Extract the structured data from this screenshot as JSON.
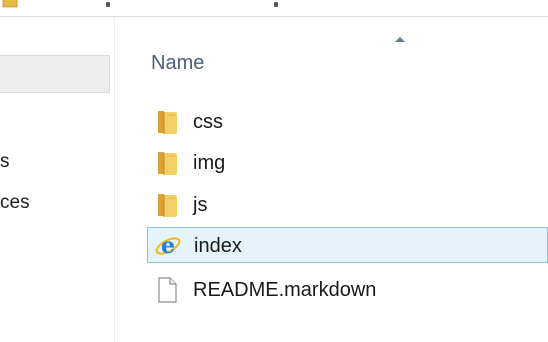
{
  "navigation": {
    "items": [
      {
        "label": ""
      },
      {
        "label": "s"
      },
      {
        "label": "ces"
      }
    ]
  },
  "file_list": {
    "columns": [
      {
        "label": "Name",
        "sorted": "ascending"
      }
    ],
    "items": [
      {
        "name": "css",
        "icon": "folder-icon",
        "selected": false
      },
      {
        "name": "img",
        "icon": "folder-icon",
        "selected": false
      },
      {
        "name": "js",
        "icon": "folder-icon",
        "selected": false
      },
      {
        "name": "index",
        "icon": "internet-explorer-icon",
        "selected": true
      },
      {
        "name": "README.markdown",
        "icon": "document-icon",
        "selected": false
      }
    ]
  },
  "colors": {
    "folder": "#e8b84a",
    "selection_fill": "#e5f3fb",
    "selection_border": "#8ac3e6",
    "header_text": "#4c607a",
    "ie_blue": "#1f7fd6",
    "ie_ring": "#f2b81c"
  }
}
